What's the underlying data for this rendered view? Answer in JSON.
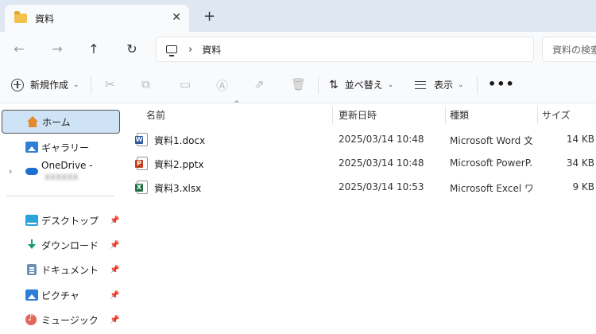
{
  "tab": {
    "title": "資料",
    "close": "✕",
    "new_tab": "+"
  },
  "nav": {
    "back": "←",
    "forward": "→",
    "up": "↑",
    "refresh": "↻"
  },
  "address": {
    "separator": "›",
    "crumb": "資料"
  },
  "search": {
    "placeholder": "資料の検索"
  },
  "commands": {
    "new_label": "新規作成",
    "sort_label": "並べ替え",
    "view_label": "表示",
    "more": "•••"
  },
  "sidebar": {
    "items": [
      {
        "label": "ホーム",
        "icon": "home-icon"
      },
      {
        "label": "ギャラリー",
        "icon": "gallery-icon"
      },
      {
        "label": "OneDrive -",
        "icon": "onedrive-cloud-icon",
        "expander": "›"
      },
      {
        "label": "デスクトップ",
        "icon": "desktop-icon",
        "pinned": true
      },
      {
        "label": "ダウンロード",
        "icon": "download-icon",
        "pinned": true
      },
      {
        "label": "ドキュメント",
        "icon": "documents-icon",
        "pinned": true
      },
      {
        "label": "ピクチャ",
        "icon": "pictures-icon",
        "pinned": true
      },
      {
        "label": "ミュージック",
        "icon": "music-icon",
        "pinned": true
      }
    ]
  },
  "columns": {
    "name": "名前",
    "date": "更新日時",
    "type": "種類",
    "size": "サイズ"
  },
  "files": [
    {
      "name": "資料1.docx",
      "date": "2025/03/14 10:48",
      "type": "Microsoft Word 文...",
      "size": "14 KB",
      "icon": "word-file-icon",
      "badge": "W",
      "color": "#2b579a"
    },
    {
      "name": "資料2.pptx",
      "date": "2025/03/14 10:48",
      "type": "Microsoft PowerP...",
      "size": "34 KB",
      "icon": "powerpoint-file-icon",
      "badge": "P",
      "color": "#c43e1c"
    },
    {
      "name": "資料3.xlsx",
      "date": "2025/03/14 10:53",
      "type": "Microsoft Excel ワ...",
      "size": "9 KB",
      "icon": "excel-file-icon",
      "badge": "X",
      "color": "#217346"
    }
  ]
}
